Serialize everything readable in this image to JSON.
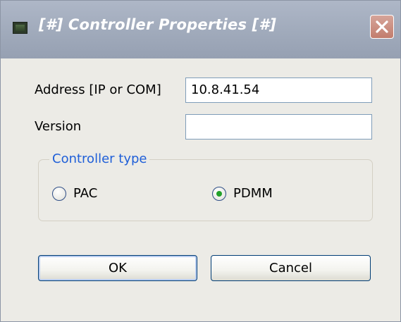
{
  "window": {
    "title": "[#] Controller Properties [#]",
    "icons": {
      "app": "app-window-icon",
      "close": "close-icon"
    }
  },
  "form": {
    "address_label": "Address [IP or COM]",
    "address_value": "10.8.41.54",
    "version_label": "Version",
    "version_value": ""
  },
  "controller_type": {
    "legend": "Controller type",
    "options": [
      {
        "label": "PAC",
        "selected": false
      },
      {
        "label": "PDMM",
        "selected": true
      }
    ]
  },
  "buttons": {
    "ok_label": "OK",
    "cancel_label": "Cancel"
  },
  "colors": {
    "accent_legend": "#1f5fd8",
    "radio_selected": "#22a02a",
    "close_button": "#c27d6d"
  }
}
